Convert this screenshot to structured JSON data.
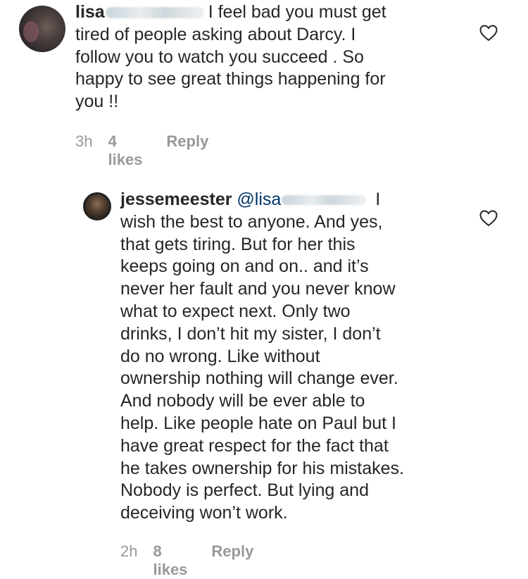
{
  "comments": [
    {
      "username": "lisa",
      "text": "I feel bad you must get\ntired of people asking about Darcy.  I\nfollow you to watch you succeed . So\nhappy to see great things happening for\nyou !!",
      "time": "3h",
      "likes": "4 likes",
      "reply": "Reply",
      "icon": "heart-outline-icon"
    },
    {
      "username": "jessemeester",
      "mention": "@lisa",
      "text": " I\nwish the best to anyone. And yes,\nthat gets tiring. But for her this\nkeeps going on and on.. and it’s\nnever her fault and you never know\nwhat to expect next. Only two\ndrinks, I don’t hit my sister, I don’t\ndo no wrong. Like without\nownership nothing will change ever.\nAnd nobody will be ever able to\nhelp. Like people hate on Paul but I\nhave great respect for the fact that\nhe takes ownership for his mistakes.\nNobody is perfect. But lying and\ndeceiving won’t work.",
      "time": "2h",
      "likes": "8 likes",
      "reply": "Reply",
      "icon": "heart-outline-icon"
    }
  ],
  "colors": {
    "text": "#262626",
    "meta": "#999999",
    "mention": "#003569"
  }
}
